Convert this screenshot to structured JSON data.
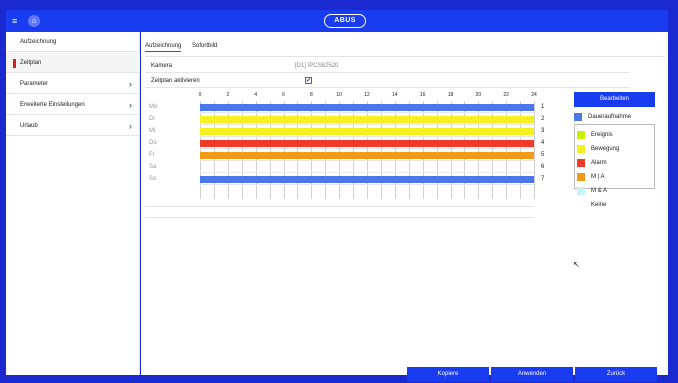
{
  "header": {
    "logo_text": "ABUS",
    "menu_icon": "menu-icon",
    "home_icon": "home-icon",
    "accent_color": "#1a3cf0"
  },
  "sidebar": {
    "items": [
      {
        "label": "Aufzeichnung",
        "active": false,
        "has_arrow": false
      },
      {
        "label": "Zeitplan",
        "active": true,
        "has_arrow": false
      },
      {
        "label": "Parameter",
        "active": false,
        "has_arrow": true
      },
      {
        "label": "Erweiterte Einstellungen",
        "active": false,
        "has_arrow": true
      },
      {
        "label": "Urlaub",
        "active": false,
        "has_arrow": true
      }
    ]
  },
  "tabs": [
    {
      "label": "Aufzeichnung",
      "active": true
    },
    {
      "label": "Sofortbild",
      "active": false
    }
  ],
  "fields": {
    "camera_label": "Kamera",
    "camera_value": "[D1] IPCS62520",
    "schedule_enable_label": "Zeitplan aktivieren",
    "schedule_enabled": true
  },
  "schedule": {
    "hour_labels": [
      "0",
      "2",
      "4",
      "6",
      "8",
      "10",
      "12",
      "14",
      "16",
      "18",
      "20",
      "22",
      "24"
    ],
    "days": [
      {
        "label": "Mo",
        "num": "1",
        "type": "Daueraufnahme"
      },
      {
        "label": "Di",
        "num": "2",
        "type": "Bewegung"
      },
      {
        "label": "Mi",
        "num": "3",
        "type": "Bewegung"
      },
      {
        "label": "Do",
        "num": "4",
        "type": "Alarm"
      },
      {
        "label": "Fr",
        "num": "5",
        "type": "M | A"
      },
      {
        "label": "Sa",
        "num": "6",
        "type": "Keine"
      },
      {
        "label": "So",
        "num": "7",
        "type": "Daueraufnahme"
      }
    ]
  },
  "legend": {
    "edit_label": "Bearbeiten",
    "items": [
      {
        "label": "Daueraufnahme",
        "color": "#4a78e8"
      },
      {
        "label": "Ereignis",
        "color": "#c8f000"
      },
      {
        "label": "Bewegung",
        "color": "#f6f020"
      },
      {
        "label": "Alarm",
        "color": "#ee3b2a"
      },
      {
        "label": "M | A",
        "color": "#f39a1b"
      },
      {
        "label": "M & A",
        "color": "#c9f4f4"
      },
      {
        "label": "Keine",
        "color": ""
      }
    ]
  },
  "footer": {
    "copy_label": "Kopiere",
    "apply_label": "Anwenden",
    "back_label": "Zurück"
  }
}
